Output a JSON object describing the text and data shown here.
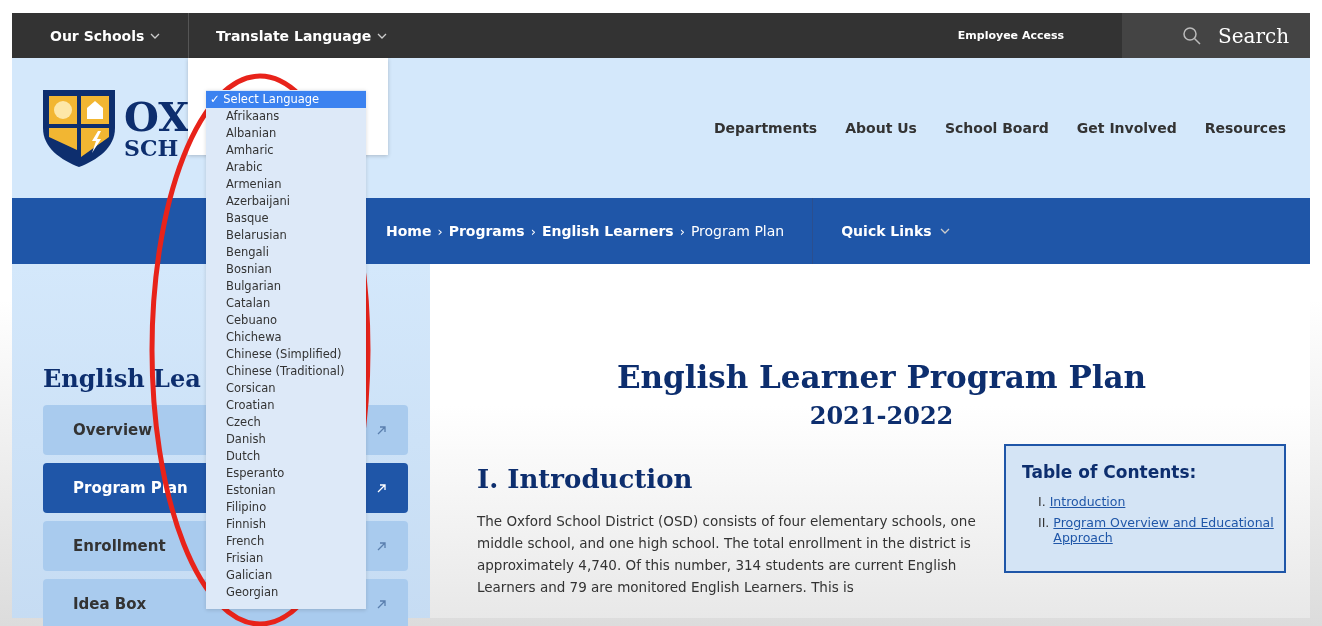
{
  "top_bar": {
    "menus": [
      {
        "label": "Our Schools"
      },
      {
        "label": "Translate Language"
      }
    ],
    "employee_link": "Employee Access",
    "search": {
      "label": "Search"
    }
  },
  "header": {
    "logo_lines": [
      "OX",
      "SCH"
    ],
    "nav": [
      "Departments",
      "About Us",
      "School Board",
      "Get Involved",
      "Resources"
    ]
  },
  "breadcrumb": [
    {
      "label": "Home",
      "current": false
    },
    {
      "label": "Programs",
      "current": false
    },
    {
      "label": "English Learners",
      "current": false
    },
    {
      "label": "Program Plan",
      "current": true
    }
  ],
  "breadcrumb_separator": "›",
  "quick_links": "Quick Links",
  "sidebar": {
    "heading": "English Lea",
    "items": [
      {
        "label": "Overview",
        "selected": false
      },
      {
        "label": "Program Plan",
        "selected": true
      },
      {
        "label": "Enrollment",
        "selected": false
      },
      {
        "label": "Idea Box",
        "selected": false
      }
    ]
  },
  "main": {
    "title": "English Learner Program Plan",
    "subtitle": "2021-2022",
    "section_heading": "I. Introduction",
    "paragraph": "The Oxford School District (OSD) consists of four elementary schools, one middle school, and one high school.  The total enrollment in the district is approximately 4,740.  Of this number, 314 students are current English Learners and 79 are monitored English Learners.  This is",
    "toc": {
      "title": "Table of Contents:",
      "items": [
        {
          "number": "I.",
          "label": "Introduction"
        },
        {
          "number": "II.",
          "label": "Program Overview and Educational Approach"
        }
      ]
    }
  },
  "language_menu": {
    "check": "✓",
    "options": [
      {
        "label": "Select Language",
        "selected": true
      },
      {
        "label": "Afrikaans",
        "selected": false
      },
      {
        "label": "Albanian",
        "selected": false
      },
      {
        "label": "Amharic",
        "selected": false
      },
      {
        "label": "Arabic",
        "selected": false
      },
      {
        "label": "Armenian",
        "selected": false
      },
      {
        "label": "Azerbaijani",
        "selected": false
      },
      {
        "label": "Basque",
        "selected": false
      },
      {
        "label": "Belarusian",
        "selected": false
      },
      {
        "label": "Bengali",
        "selected": false
      },
      {
        "label": "Bosnian",
        "selected": false
      },
      {
        "label": "Bulgarian",
        "selected": false
      },
      {
        "label": "Catalan",
        "selected": false
      },
      {
        "label": "Cebuano",
        "selected": false
      },
      {
        "label": "Chichewa",
        "selected": false
      },
      {
        "label": "Chinese (Simplified)",
        "selected": false
      },
      {
        "label": "Chinese (Traditional)",
        "selected": false
      },
      {
        "label": "Corsican",
        "selected": false
      },
      {
        "label": "Croatian",
        "selected": false
      },
      {
        "label": "Czech",
        "selected": false
      },
      {
        "label": "Danish",
        "selected": false
      },
      {
        "label": "Dutch",
        "selected": false
      },
      {
        "label": "Esperanto",
        "selected": false
      },
      {
        "label": "Estonian",
        "selected": false
      },
      {
        "label": "Filipino",
        "selected": false
      },
      {
        "label": "Finnish",
        "selected": false
      },
      {
        "label": "French",
        "selected": false
      },
      {
        "label": "Frisian",
        "selected": false
      },
      {
        "label": "Galician",
        "selected": false
      },
      {
        "label": "Georgian",
        "selected": false
      }
    ]
  }
}
